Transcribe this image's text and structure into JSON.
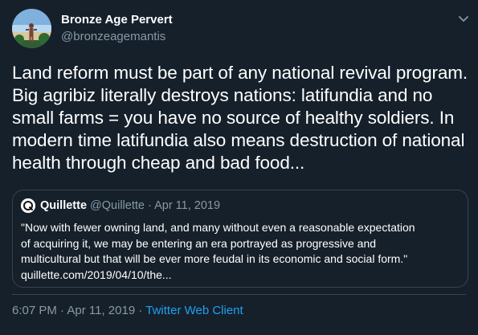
{
  "author": {
    "display_name": "Bronze Age Pervert",
    "handle": "@bronzeagemantis",
    "avatar_icon": "profile-photo"
  },
  "tweet": {
    "text": "Land reform must be part of any national revival program.\nBig agribiz literally destroys nations: latifundia and no\nsmall farms = you have no source of healthy soldiers. In\nmodern time latifundia also means destruction of national\nhealth through cheap and bad food..."
  },
  "quoted": {
    "name": "Quillette",
    "handle": "@Quillette",
    "separator": "·",
    "date": "Apr 11, 2019",
    "text": "\"Now with fewer owning land, and many without even a reasonable expectation\nof acquiring it, we may be entering an era portrayed as progressive and\nmulticultural but that will be ever more feudal in its economic and social form.\"\nquillette.com/2019/04/10/the..."
  },
  "meta": {
    "time": "6:07 PM",
    "separator": "·",
    "date": "Apr 11, 2019",
    "client": "Twitter Web Client"
  },
  "colors": {
    "background": "#15202b",
    "secondary_text": "#8899a6",
    "accent": "#1da1f2",
    "border": "#38444d"
  }
}
